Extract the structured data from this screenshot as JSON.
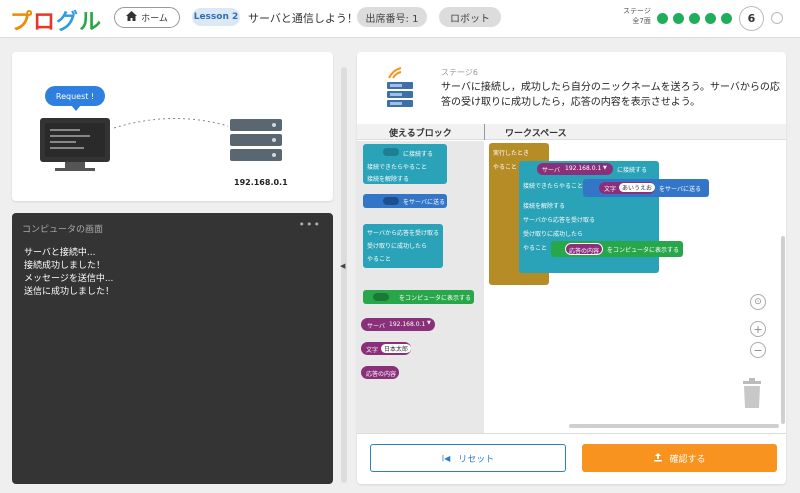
{
  "header": {
    "logo": [
      "プ",
      "ロ",
      "グ",
      "ル"
    ],
    "home_label": "ホーム",
    "lesson_pill": "Lesson 2",
    "lesson_title": "サーバと通信しよう！",
    "attendance": "出席番号: 1",
    "robot": "ロボット",
    "stage_label_line1": "ステージ",
    "stage_label_line2": "全7面",
    "current_stage": "6"
  },
  "illustration": {
    "bubble": "Request !",
    "ip": "192.168.0.1"
  },
  "console": {
    "title": "コンピュータの画面",
    "lines": [
      "サーバと接続中...",
      "接続成功しました！",
      "メッセージを送信中...",
      "送信に成功しました！"
    ]
  },
  "stage": {
    "subtitle": "ステージ6",
    "instruction": "サーバに接続し，成功したら自分のニックネームを送ろう。サーバからの応答の受け取りに成功したら，応答の内容を表示させよう。"
  },
  "editor": {
    "palette_header": "使えるブロック",
    "workspace_header": "ワークスペース",
    "palette": {
      "connect_title": "に接続する",
      "connect_success": "接続できたらやること",
      "connect_release": "接続を解除する",
      "send_to_server": "をサーバに送る",
      "receive_title": "サーバから応答を受け取る",
      "receive_success": "受け取りに成功したら",
      "do_label": "やること",
      "display": "をコンピュータに表示する",
      "server_pill": "サーバ",
      "server_value": "192.168.0.1",
      "text_pill": "文字",
      "text_value": "日本太郎",
      "response_pill": "応答の内容"
    },
    "workspace": {
      "on_run": "実行したとき",
      "do_label": "やること",
      "server_pill": "サーバ",
      "server_value": "192.168.0.1",
      "connect_label": "に接続する",
      "connect_success": "接続できたらやること",
      "text_pill": "文字",
      "text_value": "あいうえお",
      "send_label": "をサーバに送る",
      "release": "接続を解除する",
      "receive_title": "サーバから応答を受け取る",
      "receive_success": "受け取りに成功したら",
      "do_label2": "やること",
      "response_pill": "応答の内容",
      "display_label": "をコンピュータに表示する"
    }
  },
  "buttons": {
    "reset": "リセット",
    "confirm": "確認する"
  },
  "colors": {
    "accent_orange": "#f7931e",
    "block_teal": "#2aa2b8",
    "block_blue": "#3376c8",
    "block_green": "#28a64a",
    "block_gold": "#b58c25",
    "block_purple": "#8a2f7a",
    "progress_green": "#1faf5b"
  }
}
